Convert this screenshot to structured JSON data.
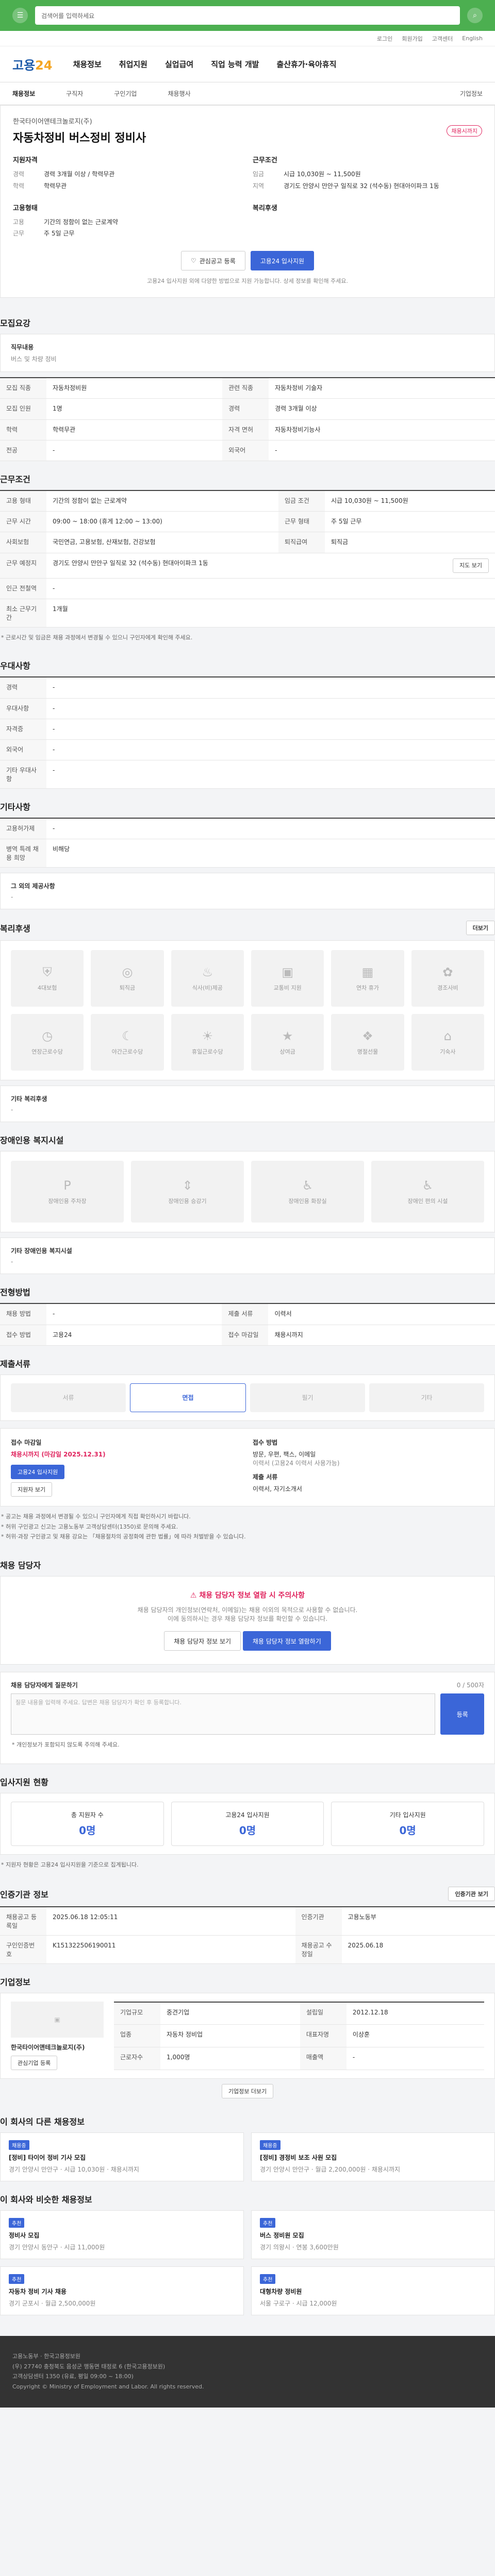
{
  "topbar": {
    "search_placeholder": "검색어를 입력하세요",
    "logo": "고용24",
    "menu_label": "메뉴"
  },
  "util": [
    "로그인",
    "회원가입",
    "고객센터",
    "English"
  ],
  "header": {
    "logo_a": "고용",
    "logo_b": "24",
    "gnb": [
      "채용정보",
      "취업지원",
      "실업급여",
      "직업 능력 개발",
      "출산휴가·육아휴직"
    ]
  },
  "subnav": {
    "items": [
      "채용정보",
      "구직자",
      "구인기업",
      "채용행사"
    ],
    "right": "기업정보"
  },
  "summary": {
    "company": "한국타이어앤테크놀로지(주)",
    "title": "자동차정비 버스정비 정비사",
    "flag": "채용시까지",
    "qual_title": "지원자격",
    "qual": [
      {
        "k": "경력",
        "v": "경력 3개월 이상 / 학력무관"
      },
      {
        "k": "학력",
        "v": "학력무관"
      }
    ],
    "cond_title": "근무조건",
    "cond": [
      {
        "k": "임금",
        "v": "시급 10,030원 ~ 11,500원"
      },
      {
        "k": "지역",
        "v": "경기도 안양시 만안구 일직로 32 (석수동) 현대아이파크 1동"
      }
    ],
    "type_title": "고용형태",
    "type": [
      {
        "k": "고용",
        "v": "기간의 정함이 없는 근로계약"
      },
      {
        "k": "근무",
        "v": "주 5일 근무"
      }
    ],
    "welfare_title": "복리후생",
    "save_btn": "관심공고 등록",
    "apply_btn": "고용24 입사지원",
    "note": "고용24 입사지원 외에 다양한 방법으로 지원 가능합니다. 상세 정보를 확인해 주세요."
  },
  "sections": {
    "job": "모집요강",
    "work": "근무조건",
    "pref": "우대사항",
    "other": "기타사항",
    "welfare": "복리후생",
    "facility": "장애인용 복지시설",
    "process": "전형방법",
    "docs": "제출서류",
    "manager": "채용 담당자",
    "status": "입사지원 현황",
    "info": "인증기관 정보",
    "company": "기업정보",
    "other_jobs": "이 회사의 다른 채용정보",
    "recommend": "이 회사와 비슷한 채용정보"
  },
  "job": {
    "desc_title": "직무내용",
    "desc": "버스 및 차량 정비",
    "rows": [
      {
        "k": "모집 직종",
        "v": "자동차정비원",
        "k2": "관련 직종",
        "v2": "자동차정비 기술자"
      },
      {
        "k": "모집 인원",
        "v": "1명",
        "k2": "경력",
        "v2": "경력 3개월 이상"
      },
      {
        "k": "학력",
        "v": "학력무관",
        "k2": "자격 면허",
        "v2": "자동차정비기능사"
      },
      {
        "k": "전공",
        "v": "-",
        "k2": "외국어",
        "v2": "-"
      }
    ]
  },
  "work": {
    "rows": [
      {
        "k": "고용 형태",
        "v": "기간의 정함이 없는 근로계약",
        "k2": "임금 조건",
        "v2": "시급 10,030원 ~ 11,500원"
      },
      {
        "k": "근무 시간",
        "v": "09:00 ~ 18:00 (휴게 12:00 ~ 13:00)",
        "k2": "근무 형태",
        "v2": "주 5일 근무"
      },
      {
        "k": "사회보험",
        "v": "국민연금, 고용보험, 산재보험, 건강보험",
        "k2": "퇴직급여",
        "v2": "퇴직금"
      },
      {
        "k": "근무 예정지",
        "v": "경기도 안양시 만안구 일직로 32 (석수동) 현대아이파크 1동",
        "k2": "",
        "v2": ""
      },
      {
        "k": "인근 전철역",
        "v": "-",
        "k2": "",
        "v2": ""
      },
      {
        "k": "최소 근무기간",
        "v": "1개월",
        "k2": "",
        "v2": ""
      }
    ],
    "map_btn": "지도 보기",
    "note": "* 근로시간 및 임금은 채용 과정에서 변경될 수 있으니 구인자에게 확인해 주세요."
  },
  "pref": {
    "rows": [
      {
        "k": "경력",
        "v": "-"
      },
      {
        "k": "우대사항",
        "v": "-"
      },
      {
        "k": "자격증",
        "v": "-"
      },
      {
        "k": "외국어",
        "v": "-"
      },
      {
        "k": "기타 우대사항",
        "v": "-"
      }
    ]
  },
  "other": {
    "rows": [
      {
        "k": "고용허가제",
        "v": "-"
      },
      {
        "k": "병역 특례 채용 희망",
        "v": "비해당"
      }
    ],
    "extra_title": "그 외의 제공사항",
    "extra": "-"
  },
  "welfare": {
    "items": [
      "4대보험",
      "퇴직금",
      "식사(비)제공",
      "교통비 지원",
      "연차 휴가",
      "경조사비",
      "연장근로수당",
      "야간근로수당",
      "휴일근로수당",
      "상여금",
      "명절선물",
      "기숙사"
    ],
    "extra_title": "기타 복리후생",
    "extra": "-",
    "more_btn": "더보기"
  },
  "facility": {
    "items": [
      "장애인용 주차장",
      "장애인용 승강기",
      "장애인용 화장실",
      "장애인 편의 시설"
    ],
    "extra_title": "기타 장애인용 복지시설",
    "extra": "-"
  },
  "process": {
    "steps": [
      "서류",
      "면접",
      "필기",
      "기타"
    ],
    "on_index": 1,
    "rows": [
      {
        "k": "채용 방법",
        "v": "-",
        "k2": "제출 서류",
        "v2": "이력서"
      },
      {
        "k": "접수 방법",
        "v": "고용24",
        "k2": "접수 마감일",
        "v2": "채용시까지"
      }
    ]
  },
  "method": {
    "left_title": "접수 마감일",
    "left_value": "채용시까지 (마감일 2025.12.31)",
    "apply_btn": "고용24 입사지원",
    "view_btn": "지원자 보기",
    "right_title": "접수 방법",
    "right_lines": [
      "방문, 우편, 팩스, 이메일",
      "이력서 (고용24 이력서 사용가능)"
    ],
    "right_title2": "제출 서류",
    "right_value2": "이력서, 자기소개서"
  },
  "notes": [
    "* 공고는 채용 과정에서 변경될 수 있으니 구인자에게 직접 확인하시기 바랍니다.",
    "* 허위 구인광고 신고는 고용노동부 고객상담센터(1350)로 문의해 주세요.",
    "* 허위·과장 구인광고 및 채용 강요는 「채용절차의 공정화에 관한 법률」에 따라 처벌받을 수 있습니다."
  ],
  "alert": {
    "title": "채용 담당자 정보 열람 시 주의사항",
    "line1": "채용 담당자의 개인정보(연락처, 이메일)는 채용 이외의 목적으로 사용할 수 없습니다.",
    "line2": "이에 동의하시는 경우 채용 담당자 정보를 확인할 수 있습니다.",
    "btn_a": "채용 담당자 정보 보기",
    "btn_b": "채용 담당자 정보 열람하기"
  },
  "inquiry": {
    "title": "채용 담당자에게 질문하기",
    "placeholder": "질문 내용을 입력해 주세요. 답변은 채용 담당자가 확인 후 등록합니다.",
    "count": "0 / 500자",
    "submit": "등록",
    "warn": "* 개인정보가 포함되지 않도록 주의해 주세요."
  },
  "status": {
    "items": [
      {
        "label": "총 지원자 수",
        "value": "0명"
      },
      {
        "label": "고용24 입사지원",
        "value": "0명"
      },
      {
        "label": "기타 입사지원",
        "value": "0명"
      }
    ],
    "note": "* 지원자 현황은 고용24 입사지원을 기준으로 집계됩니다."
  },
  "info": {
    "rows": [
      {
        "k": "채용공고 등록일",
        "v": "2025.06.18 12:05:11",
        "k2": "인증기관",
        "v2": "고용노동부"
      },
      {
        "k": "구인인증번호",
        "v": "K151322506190011",
        "k2": "채용공고 수정일",
        "v2": "2025.06.18"
      }
    ],
    "btn": "인증기관 보기"
  },
  "company": {
    "name": "한국타이어앤테크놀로지(주)",
    "rows": [
      {
        "k": "기업규모",
        "v": "중견기업",
        "k2": "설립일",
        "v2": "2012.12.18"
      },
      {
        "k": "업종",
        "v": "자동차 정비업",
        "k2": "대표자명",
        "v2": "이상훈"
      },
      {
        "k": "근로자수",
        "v": "1,000명",
        "k2": "매출액",
        "v2": "-"
      }
    ],
    "btn_follow": "관심기업 등록",
    "btn_more": "기업정보 더보기"
  },
  "other_jobs": [
    {
      "badge": "채용중",
      "title": "[정비] 타이어 정비 기사 모집",
      "meta": "경기 안양시 만안구 · 시급 10,030원 · 채용시까지"
    },
    {
      "badge": "채용중",
      "title": "[정비] 경정비 보조 사원 모집",
      "meta": "경기 안양시 만안구 · 월급 2,200,000원 · 채용시까지"
    }
  ],
  "recommend": [
    {
      "badge": "추천",
      "title": "정비사 모집",
      "meta": "경기 안양시 동안구 · 시급 11,000원"
    },
    {
      "badge": "추천",
      "title": "버스 정비원 모집",
      "meta": "경기 의왕시 · 연봉 3,600만원"
    },
    {
      "badge": "추천",
      "title": "자동차 정비 기사 채용",
      "meta": "경기 군포시 · 월급 2,500,000원"
    },
    {
      "badge": "추천",
      "title": "대형차량 정비원",
      "meta": "서울 구로구 · 시급 12,000원"
    }
  ],
  "footer": {
    "line1": "고용노동부 · 한국고용정보원",
    "line2": "(우) 27740 충청북도 음성군 맹동면 태정로 6 (한국고용정보원)",
    "line3": "고객상담센터 1350 (유료, 평일 09:00 ~ 18:00)",
    "copy": "Copyright © Ministry of Employment and Labor. All rights reserved."
  },
  "colors": {
    "topbar": "#4caf50",
    "primary": "#3b66d8",
    "alert": "#e0245e"
  }
}
